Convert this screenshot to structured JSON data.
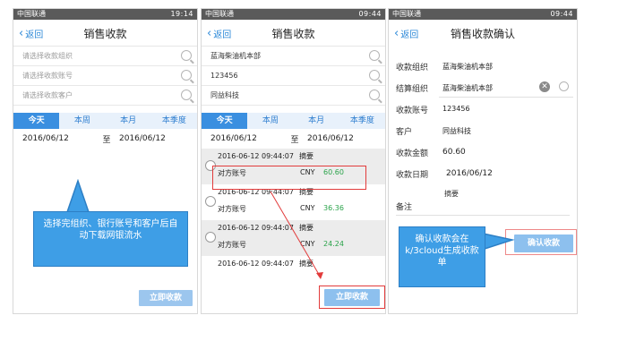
{
  "status": {
    "carrier": "中国联通",
    "time1": "19:14",
    "time2": "09:44",
    "time3": "09:44"
  },
  "screen1": {
    "back": "返回",
    "title": "销售收款",
    "fields": [
      "请选择收款组织",
      "请选择收款账号",
      "请选择收款客户"
    ],
    "tabs": [
      "今天",
      "本周",
      "本月",
      "本季度"
    ],
    "date_from": "2016/06/12",
    "to": "至",
    "date_to": "2016/06/12",
    "button": "立即收款",
    "callout": "选择完组织、银行账号和客户后自动下载网银流水"
  },
  "screen2": {
    "back": "返回",
    "title": "销售收款",
    "fields": [
      "蓝海柴油机本部",
      "123456",
      "同益科技"
    ],
    "tabs": [
      "今天",
      "本周",
      "本月",
      "本季度"
    ],
    "date_from": "2016/06/12",
    "to": "至",
    "date_to": "2016/06/12",
    "items": [
      {
        "datetime": "2016-06-12 09:44:07",
        "memo": "摘要",
        "account": "对方账号",
        "currency": "CNY",
        "amount": "60.60"
      },
      {
        "datetime": "2016-06-12 09:44:07",
        "memo": "摘要",
        "account": "对方账号",
        "currency": "CNY",
        "amount": "36.36"
      },
      {
        "datetime": "2016-06-12 09:44:07",
        "memo": "摘要",
        "account": "对方账号",
        "currency": "CNY",
        "amount": "24.24"
      },
      {
        "datetime": "2016-06-12 09:44:07",
        "memo": "摘要"
      }
    ],
    "button": "立即收款"
  },
  "screen3": {
    "back": "返回",
    "title": "销售收款确认",
    "labels": {
      "org": "收款组织",
      "settle_org": "结算组织",
      "account": "收款账号",
      "customer": "客户",
      "amount": "收款金额",
      "date": "收款日期",
      "memo": "摘要",
      "remark": "备注"
    },
    "values": {
      "settle_org": "蓝海柴油机本部",
      "org": "蓝海柴油机本部",
      "account": "123456",
      "customer": "同益科技",
      "amount": "60.60",
      "date": "2016/06/12"
    },
    "button": "确认收款",
    "callout": "确认收款会在k/3cloud生成收款单"
  },
  "colors": {
    "accent": "#3a8fe0",
    "button": "#9cc6ee",
    "amount": "#2aa34a",
    "highlight": "#e23b3b",
    "callout": "#3e9ee6"
  }
}
